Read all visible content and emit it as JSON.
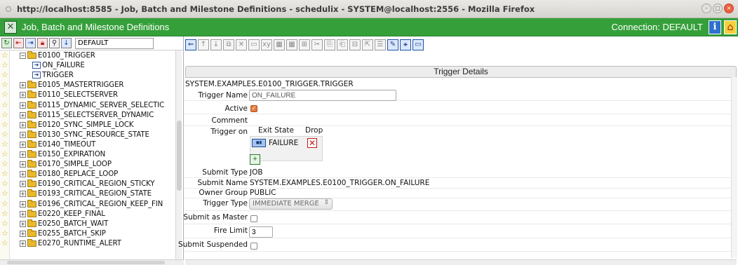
{
  "browser": {
    "title": "http://localhost:8585 - Job, Batch and Milestone Definitions - schedulix - SYSTEM@localhost:2556 - Mozilla Firefox"
  },
  "app": {
    "title": "Job, Batch and Milestone Definitions",
    "connection": "Connection: DEFAULT",
    "info_icon": "i",
    "home_icon": "home-icon"
  },
  "left_toolbar": {
    "filter_value": "DEFAULT"
  },
  "tree": {
    "items": [
      {
        "label": "E0100_TRIGGER",
        "kind": "folder-open"
      },
      {
        "label": "ON_FAILURE",
        "kind": "trigger"
      },
      {
        "label": "TRIGGER",
        "kind": "trigger"
      },
      {
        "label": "E0105_MASTERTRIGGER",
        "kind": "folder"
      },
      {
        "label": "E0110_SELECTSERVER",
        "kind": "folder"
      },
      {
        "label": "E0115_DYNAMIC_SERVER_SELECTIC",
        "kind": "folder"
      },
      {
        "label": "E0115_SELECTSERVER_DYNAMIC",
        "kind": "folder"
      },
      {
        "label": "E0120_SYNC_SIMPLE_LOCK",
        "kind": "folder"
      },
      {
        "label": "E0130_SYNC_RESOURCE_STATE",
        "kind": "folder"
      },
      {
        "label": "E0140_TIMEOUT",
        "kind": "folder"
      },
      {
        "label": "E0150_EXPIRATION",
        "kind": "folder"
      },
      {
        "label": "E0170_SIMPLE_LOOP",
        "kind": "folder"
      },
      {
        "label": "E0180_REPLACE_LOOP",
        "kind": "folder"
      },
      {
        "label": "E0190_CRITICAL_REGION_STICKY",
        "kind": "folder"
      },
      {
        "label": "E0193_CRITICAL_REGION_STATE",
        "kind": "folder"
      },
      {
        "label": "E0196_CRITICAL_REGION_KEEP_FIN",
        "kind": "folder"
      },
      {
        "label": "E0220_KEEP_FINAL",
        "kind": "folder"
      },
      {
        "label": "E0250_BATCH_WAIT",
        "kind": "folder"
      },
      {
        "label": "E0255_BATCH_SKIP",
        "kind": "folder"
      },
      {
        "label": "E0270_RUNTIME_ALERT",
        "kind": "folder"
      }
    ]
  },
  "details": {
    "header": "Trigger Details",
    "path": "SYSTEM.EXAMPLES.E0100_TRIGGER.TRIGGER",
    "labels": {
      "trigger_name": "Trigger Name",
      "active": "Active",
      "comment": "Comment",
      "trigger_on": "Trigger on",
      "submit_type": "Submit Type",
      "submit_name": "Submit Name",
      "owner_group": "Owner Group",
      "trigger_type": "Trigger Type",
      "submit_as_master": "Submit as Master",
      "fire_limit": "Fire Limit",
      "submit_suspended": "Submit Suspended"
    },
    "trigger_name": "ON_FAILURE",
    "active": true,
    "comment": "",
    "trigger_on": {
      "col_exit_state": "Exit State",
      "col_drop": "Drop",
      "rows": [
        {
          "exit_state": "FAILURE"
        }
      ]
    },
    "submit_type": "JOB",
    "submit_name": "SYSTEM.EXAMPLES.E0100_TRIGGER.ON_FAILURE",
    "owner_group": "PUBLIC",
    "trigger_type": "IMMEDIATE MERGE",
    "submit_as_master": false,
    "fire_limit": "3",
    "submit_suspended": false
  },
  "colors": {
    "app_bar": "#35a03a",
    "checked_orange": "#e07a3f",
    "drop_red": "#c01a1a"
  }
}
